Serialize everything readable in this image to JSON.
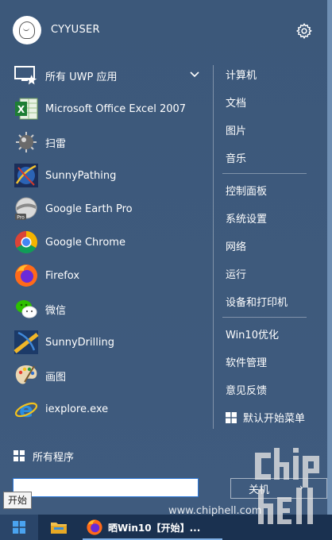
{
  "user": {
    "name": "CYYUSER"
  },
  "left_items": [
    {
      "label": "所有 UWP 应用",
      "icon": "uwp-apps-icon"
    },
    {
      "label": "Microsoft Office Excel 2007",
      "icon": "excel-icon"
    },
    {
      "label": "扫雷",
      "icon": "minesweeper-icon"
    },
    {
      "label": "SunnyPathing",
      "icon": "sunnypathing-icon"
    },
    {
      "label": "Google Earth Pro",
      "icon": "google-earth-icon"
    },
    {
      "label": "Google Chrome",
      "icon": "chrome-icon"
    },
    {
      "label": "Firefox",
      "icon": "firefox-icon"
    },
    {
      "label": "微信",
      "icon": "wechat-icon"
    },
    {
      "label": "SunnyDrilling",
      "icon": "sunnydrilling-icon"
    },
    {
      "label": "画图",
      "icon": "paint-icon"
    },
    {
      "label": "iexplore.exe",
      "icon": "internet-explorer-icon"
    }
  ],
  "right_items": {
    "group1": [
      "计算机",
      "文档",
      "图片",
      "音乐"
    ],
    "group2": [
      "控制面板",
      "系统设置",
      "网络",
      "运行",
      "设备和打印机"
    ],
    "group3": [
      "Win10优化",
      "软件管理",
      "意见反馈",
      "默认开始菜单"
    ]
  },
  "all_programs": "所有程序",
  "search": {
    "value": ""
  },
  "shutdown": {
    "label": "关机",
    "arrow": "›"
  },
  "tooltip": "开始",
  "taskbar": {
    "app_label": "晒Win10【开始】..."
  },
  "watermark": {
    "url": "www.chiphell.com"
  },
  "colors": {
    "menu_bg": "#3f5b7e",
    "taskbar": "#1a3150",
    "accent": "#2d78d8"
  }
}
